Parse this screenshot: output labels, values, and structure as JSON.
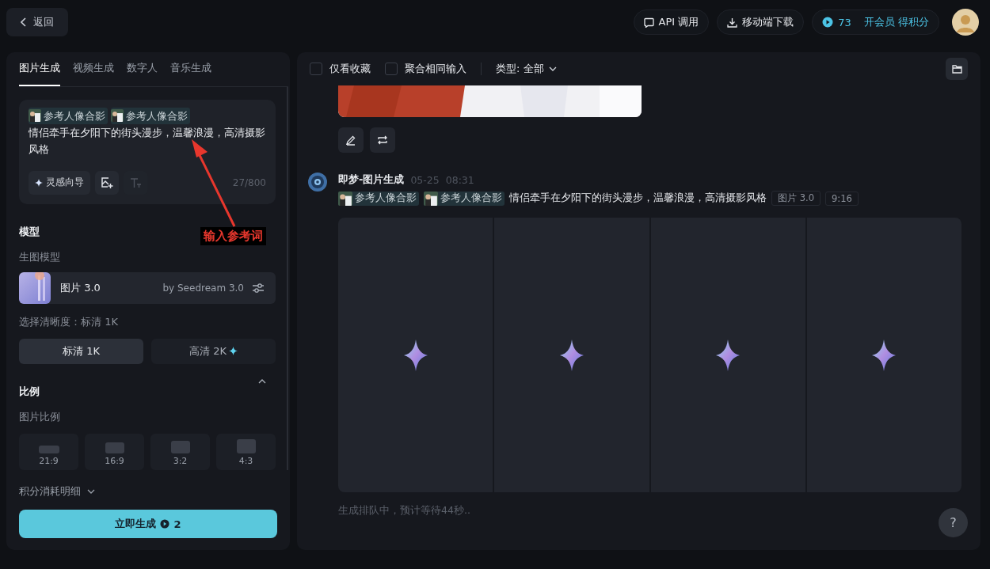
{
  "top_bar": {
    "back_button": "返回",
    "api_button": "API 调用",
    "download_button": "移动端下载",
    "credits": "73",
    "membership_link": "开会员 得积分"
  },
  "left_panel": {
    "tabs": [
      {
        "label": "图片生成",
        "selected": true
      },
      {
        "label": "视频生成",
        "selected": false
      },
      {
        "label": "数字人",
        "selected": false
      },
      {
        "label": "音乐生成",
        "selected": false
      }
    ],
    "prompt": {
      "references": [
        "参考人像合影",
        "参考人像合影"
      ],
      "text": "情侣牵手在夕阳下的街头漫步，温馨浪漫，高清摄影风格",
      "inspiration_button": "灵感向导",
      "counter": "27/800"
    },
    "model_section": {
      "title": "模型",
      "label": "生图模型",
      "model_name": "图片 3.0",
      "model_by": "by Seedream 3.0"
    },
    "resolution": {
      "label": "选择清晰度：标清 1K",
      "options": [
        {
          "label": "标清 1K",
          "selected": true,
          "premium": false
        },
        {
          "label": "高清 2K",
          "selected": false,
          "premium": true
        }
      ]
    },
    "ratio": {
      "title": "比例",
      "expanded": true,
      "label": "图片比例",
      "options": [
        {
          "label": "21:9",
          "kind": "ultrawide",
          "selected": false
        },
        {
          "label": "16:9",
          "kind": "wide",
          "selected": false
        },
        {
          "label": "3:2",
          "selected": false
        },
        {
          "label": "4:3",
          "kind": "classic",
          "selected": false
        }
      ]
    },
    "cost_detail": "积分消耗明细",
    "generate_button": {
      "label": "立即生成",
      "cost": "2"
    }
  },
  "annotation": {
    "text": "输入参考词"
  },
  "feed": {
    "filters": [
      {
        "label": "仅看收藏",
        "checked": false
      },
      {
        "label": "聚合相同输入",
        "checked": false
      }
    ],
    "type_filter": "类型: 全部",
    "entry": {
      "author": "即梦-图片生成",
      "date": "05-25",
      "time": "08:31",
      "references": [
        "参考人像合影",
        "参考人像合影"
      ],
      "prompt": "情侣牵手在夕阳下的街头漫步，温馨浪漫，高清摄影风格",
      "tags": [
        "图片 3.0",
        "9:16"
      ],
      "results": [
        {
          "loading": true
        },
        {
          "loading": true
        },
        {
          "loading": true
        },
        {
          "loading": true
        }
      ]
    },
    "status": "生成排队中，预计等待44秒..",
    "help_button": "?"
  }
}
